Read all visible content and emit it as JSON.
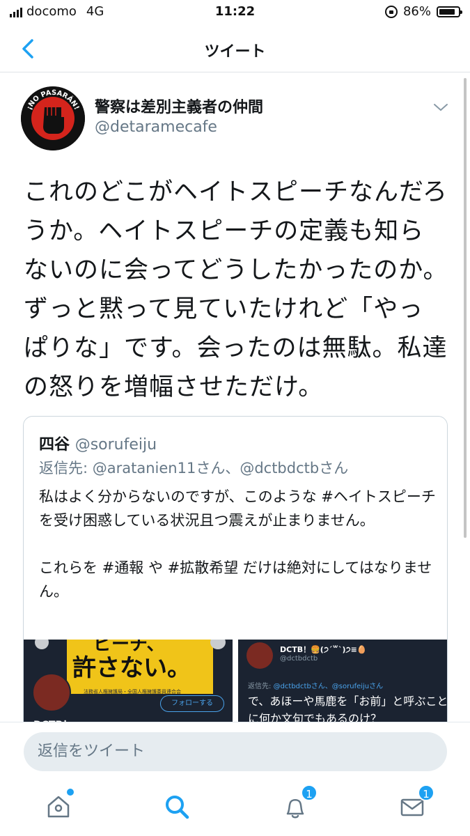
{
  "status_bar": {
    "carrier": "docomo",
    "network": "4G",
    "time": "11:22",
    "battery": "86%",
    "battery_level": 0.86
  },
  "nav": {
    "title": "ツイート",
    "back_icon": "chevron-left-icon"
  },
  "tweet": {
    "author_name": "警察は差別主義者の仲間",
    "author_handle": "@detaramecafe",
    "avatar_text": "¡NO PASARÁN!",
    "text": "これのどこがヘイトスピーチなんだろうか。ヘイトスピーチの定義も知らないのに会ってどうしたかったのか。ずっと黙って見ていたけれど「やっぱりな」です。会ったのは無駄。私達の怒りを増幅させただけ。"
  },
  "quoted_tweet": {
    "name": "四谷",
    "handle": "@sorufeiju",
    "reply_to": "返信先: @aratanien11さん、@dctbdctbさん",
    "body_1": "私はよく分からないのですが、このような #ヘイトスピーチ を受け困惑している状況且つ震えが止まりません。",
    "body_2": "これらを #通報 や #拡散希望 だけは絶対にしてはなりません。",
    "image_1": {
      "sign_text": "許さない。",
      "sign_top": "ピーチ、",
      "sign_small": "法務省人権擁護局・全国人権擁護委員連合会",
      "follow_label": "フォローする",
      "name": "DCTB！"
    },
    "image_2": {
      "name": "DCTB！🍔(੭ˊ꒳ˋ)੭≡🥚",
      "handle": "@dctbdctb",
      "reply_to_label": "返信先:",
      "reply_to_users": "@dctbdctbさん、@sorufeijuさん",
      "text": "で、あほーや馬鹿を「お前」と呼ぶことに何か文句でもあるのけ？"
    }
  },
  "reply_bar": {
    "placeholder": "返信をツイート"
  },
  "tab_bar": {
    "home_icon": "home-icon",
    "search_icon": "search-icon",
    "notifications_icon": "bell-icon",
    "notifications_badge": "1",
    "messages_icon": "envelope-icon",
    "messages_badge": "1"
  },
  "colors": {
    "accent": "#1da1f2",
    "text": "#14171a",
    "secondary": "#657786"
  }
}
